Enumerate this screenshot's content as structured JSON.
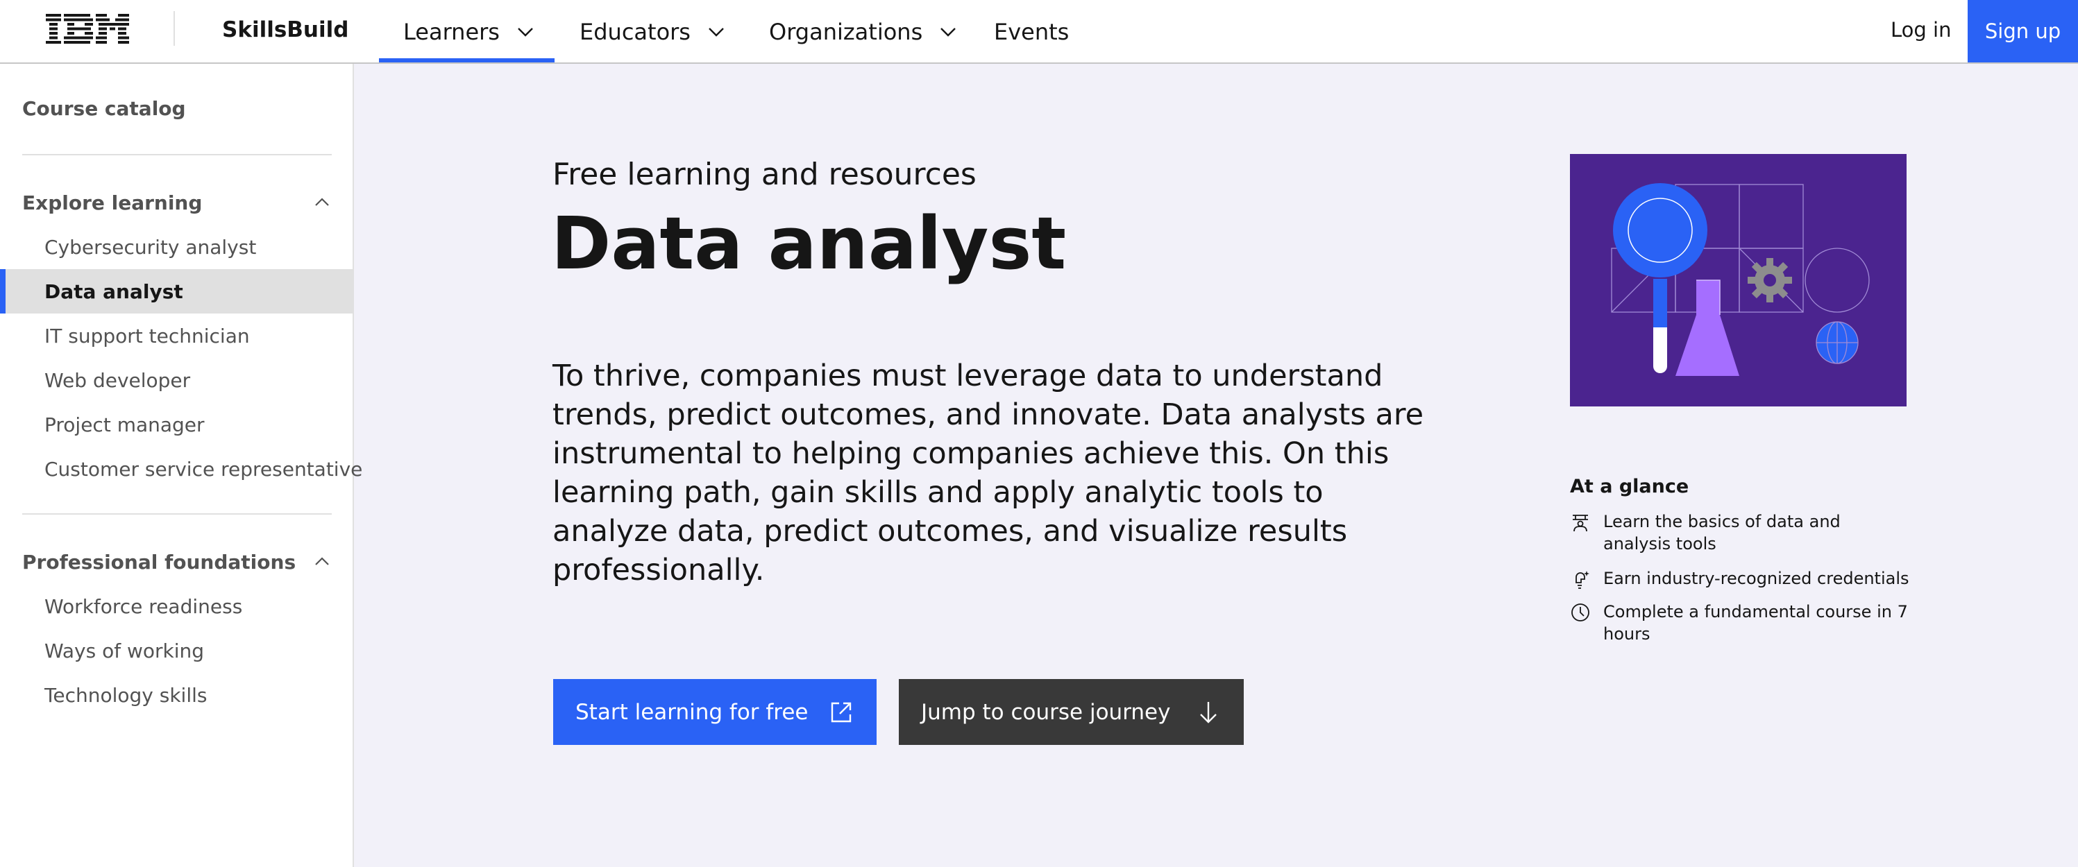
{
  "header": {
    "logo_text": "IBM",
    "brand": "SkillsBuild",
    "nav": [
      {
        "label": "Learners",
        "icon": "chevron-down-icon"
      },
      {
        "label": "Educators",
        "icon": "chevron-down-icon"
      },
      {
        "label": "Organizations",
        "icon": "chevron-down-icon"
      },
      {
        "label": "Events"
      }
    ],
    "login": "Log in",
    "signup": "Sign up"
  },
  "sidebar": {
    "catalog": "Course catalog",
    "groups": [
      {
        "title": "Explore learning",
        "icon": "chevron-up-icon",
        "items": [
          {
            "label": "Cybersecurity analyst"
          },
          {
            "label": "Data analyst",
            "active": true
          },
          {
            "label": "IT support technician"
          },
          {
            "label": "Web developer"
          },
          {
            "label": "Project manager"
          },
          {
            "label": "Customer service representative"
          }
        ]
      },
      {
        "title": "Professional foundations",
        "icon": "chevron-up-icon",
        "items": [
          {
            "label": "Workforce readiness"
          },
          {
            "label": "Ways of working"
          },
          {
            "label": "Technology skills"
          }
        ]
      }
    ]
  },
  "main": {
    "eyebrow": "Free learning and resources",
    "title": "Data analyst",
    "description": "To thrive, companies must leverage data to understand trends, predict outcomes, and innovate. Data analysts are instrumental to helping companies achieve this. On this learning path, gain skills and apply analytic tools to analyze data, predict outcomes, and visualize results professionally.",
    "buttons": {
      "primary": {
        "label": "Start learning for free",
        "icon": "launch-icon"
      },
      "secondary": {
        "label": "Jump to course journey",
        "icon": "arrow-down-icon"
      }
    }
  },
  "glance": {
    "title": "At a glance",
    "items": [
      {
        "icon": "education-icon",
        "text": "Learn the basics of data and analysis tools"
      },
      {
        "icon": "idea-icon",
        "text": "Earn industry-recognized credentials"
      },
      {
        "icon": "clock-icon",
        "text": "Complete a fundamental course in 7 hours"
      }
    ]
  },
  "colors": {
    "accent": "#2a62f5",
    "background": "#f2f1f9",
    "illustration_bg": "#4b248f",
    "secondary_button": "#393939"
  }
}
